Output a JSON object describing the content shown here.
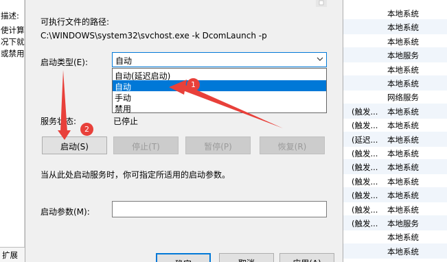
{
  "left_panel": {
    "lines": [
      "描述:",
      "使计算",
      "况下就",
      "或禁用"
    ],
    "tab": "扩展"
  },
  "right_list": {
    "rows": [
      {
        "a": "",
        "b": "本地系统"
      },
      {
        "a": "",
        "b": "本地系统"
      },
      {
        "a": "",
        "b": "本地系统"
      },
      {
        "a": "",
        "b": "本地服务"
      },
      {
        "a": "",
        "b": "本地系统"
      },
      {
        "a": "",
        "b": "本地系统"
      },
      {
        "a": "",
        "b": "网络服务"
      },
      {
        "a": "(触发...",
        "b": "本地系统"
      },
      {
        "a": "(触发...",
        "b": "本地系统"
      },
      {
        "a": "(延迟...",
        "b": "本地系统"
      },
      {
        "a": "(触发...",
        "b": "本地系统"
      },
      {
        "a": "(触发...",
        "b": "本地系统"
      },
      {
        "a": "(触发...",
        "b": "本地系统"
      },
      {
        "a": "(触发...",
        "b": "本地系统"
      },
      {
        "a": "(触发...",
        "b": "本地系统"
      },
      {
        "a": "(触发...",
        "b": "本地服务"
      },
      {
        "a": "",
        "b": "本地系统"
      },
      {
        "a": "",
        "b": "本地系统"
      }
    ]
  },
  "dialog": {
    "path_label": "可执行文件的路径:",
    "path_value": "C:\\WINDOWS\\system32\\svchost.exe -k DcomLaunch -p",
    "startup_label": "启动类型(E):",
    "startup_value": "自动",
    "startup_options": [
      "自动(延迟启动)",
      "自动",
      "手动",
      "禁用"
    ],
    "selected_option_index": 1,
    "status_label": "服务状态:",
    "status_value": "已停止",
    "buttons": {
      "start": "启动(S)",
      "stop": "停止(T)",
      "pause": "暂停(P)",
      "resume": "恢复(R)"
    },
    "hint": "当从此处启动服务时，你可指定所适用的启动参数。",
    "params_label": "启动参数(M):",
    "params_value": "",
    "footer_buttons": {
      "ok": "确定",
      "cancel": "取消",
      "apply": "应用(A)"
    }
  },
  "annotations": {
    "badge_1": "1",
    "badge_2": "2",
    "color": "#e8403a"
  }
}
